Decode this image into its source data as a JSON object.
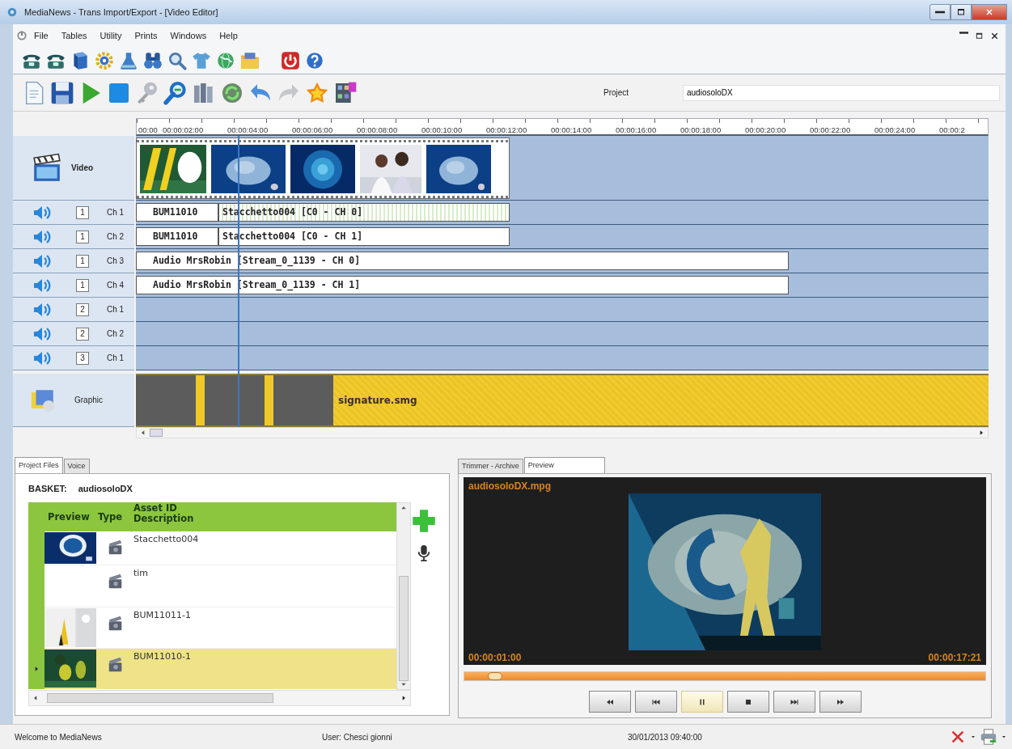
{
  "window": {
    "title": "MediaNews  - Trans Import/Export  - [Video Editor]"
  },
  "menu": [
    "File",
    "Tables",
    "Utility",
    "Prints",
    "Windows",
    "Help"
  ],
  "project": {
    "label": "Project",
    "value": "audiosoloDX"
  },
  "ruler": [
    "00:00",
    "00:00:02:00",
    "00:00:04:00",
    "00:00:06:00",
    "00:00:08:00",
    "00:00:10:00",
    "00:00:12:00",
    "00:00:14:00",
    "00:00:16:00",
    "00:00:18:00",
    "00:00:20:00",
    "00:00:22:00",
    "00:00:24:00",
    "00:00:2"
  ],
  "video_track": {
    "label": "Video"
  },
  "audio_tracks": [
    {
      "group": "1",
      "channel": "Ch 1",
      "clips": [
        "BUM11010",
        "Stacchetto004 [C0 - CH 0]"
      ]
    },
    {
      "group": "1",
      "channel": "Ch 2",
      "clips": [
        "BUM11010",
        "Stacchetto004 [C0 - CH 1]"
      ]
    },
    {
      "group": "1",
      "channel": "Ch 3",
      "clips": [
        "Audio MrsRobin [Stream_0_1139 - CH 0]"
      ]
    },
    {
      "group": "1",
      "channel": "Ch 4",
      "clips": [
        "Audio MrsRobin [Stream_0_1139 - CH 1]"
      ]
    },
    {
      "group": "2",
      "channel": "Ch 1"
    },
    {
      "group": "2",
      "channel": "Ch 2"
    },
    {
      "group": "3",
      "channel": "Ch 1"
    }
  ],
  "graphic_track": {
    "label": "Graphic",
    "clip": "signature.smg"
  },
  "project_files": {
    "tabs": [
      {
        "label": "Project Files",
        "selected": true
      },
      {
        "label": "Voice",
        "selected": false
      }
    ],
    "basket_label": "BASKET:",
    "basket": "audiosoloDX",
    "columns": [
      {
        "label": "Preview"
      },
      {
        "label": "Type"
      },
      {
        "label": "Asset ID",
        "sublabel": "Description"
      }
    ],
    "rows": [
      {
        "preview": true,
        "asset": "Stacchetto004",
        "selected": false
      },
      {
        "preview": false,
        "asset": "tim",
        "selected": false
      },
      {
        "preview": true,
        "asset": "BUM11011-1",
        "selected": false
      },
      {
        "preview": true,
        "asset": "BUM11010-1",
        "selected": true
      }
    ]
  },
  "player": {
    "tabs": [
      {
        "label": "Trimmer - Archive",
        "selected": false
      },
      {
        "label": "Preview",
        "selected": true
      }
    ],
    "file": "audiosoloDX.mpg",
    "time_current": "00:00:01:00",
    "time_total": "00:00:17:21",
    "level": 0.03,
    "buttons": [
      {
        "kind": "rewind",
        "selected": false
      },
      {
        "kind": "previous",
        "selected": false
      },
      {
        "kind": "pause",
        "selected": true
      },
      {
        "kind": "stop",
        "selected": false
      },
      {
        "kind": "next",
        "selected": false
      },
      {
        "kind": "forward",
        "selected": false
      }
    ]
  },
  "status_bar": {
    "message": "Welcome to MediaNews",
    "user": "User: Chesci gionni",
    "datetime": "30/01/2013 09:40:00"
  }
}
